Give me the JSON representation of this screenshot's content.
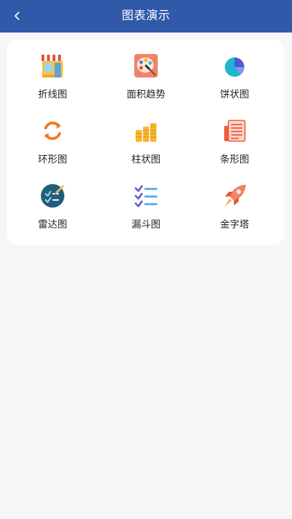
{
  "header": {
    "title": "图表演示",
    "back_icon": "chevron-left-icon"
  },
  "colors": {
    "header_bg": "#3159a9",
    "page_bg": "#f6f6f7"
  },
  "grid": {
    "items": [
      {
        "label": "折线图",
        "icon": "storefront-icon"
      },
      {
        "label": "面积趋势",
        "icon": "palette-icon"
      },
      {
        "label": "饼状图",
        "icon": "pie-chart-icon"
      },
      {
        "label": "环形图",
        "icon": "refresh-arrows-icon"
      },
      {
        "label": "柱状图",
        "icon": "coin-stacks-icon"
      },
      {
        "label": "条形图",
        "icon": "newspaper-icon"
      },
      {
        "label": "雷达图",
        "icon": "checklist-badge-icon"
      },
      {
        "label": "漏斗图",
        "icon": "checklist-icon"
      },
      {
        "label": "金字塔",
        "icon": "rocket-icon"
      }
    ]
  }
}
